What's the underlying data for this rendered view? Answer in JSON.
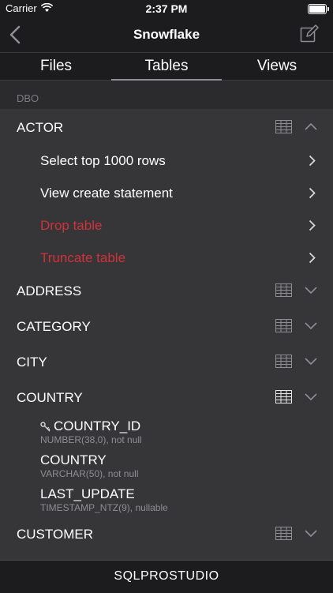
{
  "status": {
    "carrier": "Carrier",
    "time": "2:37 PM"
  },
  "nav": {
    "title": "Snowflake"
  },
  "segments": [
    "Files",
    "Tables",
    "Views"
  ],
  "schema": "DBO",
  "tables": {
    "actor": "ACTOR",
    "address": "ADDRESS",
    "category": "CATEGORY",
    "city": "CITY",
    "country": "COUNTRY",
    "customer": "CUSTOMER"
  },
  "actions": {
    "select_top": "Select top 1000 rows",
    "view_create": "View create statement",
    "drop_table": "Drop table",
    "truncate_table": "Truncate table"
  },
  "columns": [
    {
      "name": "COUNTRY_ID",
      "type": "NUMBER(38,0), not null",
      "primary_key": true
    },
    {
      "name": "COUNTRY",
      "type": "VARCHAR(50), not null"
    },
    {
      "name": "LAST_UPDATE",
      "type": "TIMESTAMP_NTZ(9), nullable"
    }
  ],
  "footer": "SQLPROSTUDIO",
  "colors": {
    "destructive": "#d0323a",
    "background": "#2b2b2d",
    "panel": "#363638"
  }
}
